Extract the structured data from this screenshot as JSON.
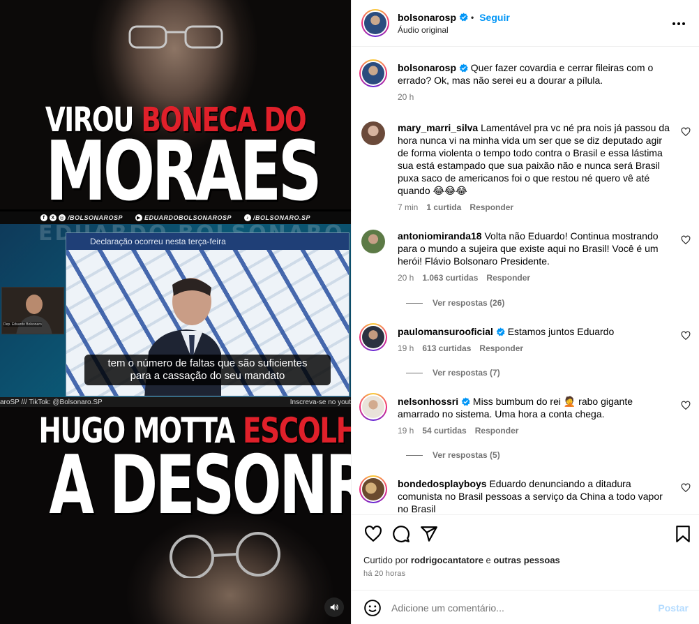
{
  "media": {
    "headline_top_white": "VIROU ",
    "headline_top_red": "BONECA DO",
    "headline_big_top": "MORAES",
    "social_handle_1": "/BOLSONAROSP",
    "social_handle_2": "EDUARDOBOLSONAROSP",
    "social_handle_3": "/BOLSONARO.SP",
    "video_bg_name": "EDUARDO BOLSONARO",
    "news_lower_third": "Declaração ocorreu nesta terça-feira",
    "caption_line_1": "tem o número de faltas que são suficientes",
    "caption_line_2": "para a cassação do seu mandato",
    "pip_label": "Dep. Eduardo Bolsonaro",
    "video_bar_left": "aroSP /// TikTok: @Bolsonaro.SP",
    "video_bar_right": "Inscreva-se no yout",
    "headline_bottom_white": "HUGO MOTTA ",
    "headline_bottom_red": "ESCOLHEU",
    "headline_big_bottom": "A DESONRA"
  },
  "header": {
    "username": "bolsonarosp",
    "bullet": "•",
    "follow_label": "Seguir",
    "audio_label": "Áudio original"
  },
  "caption": {
    "username": "bolsonarosp",
    "text": "Quer fazer covardia e cerrar fileiras com o errado? Ok, mas não serei eu a dourar a pílula.",
    "time": "20 h"
  },
  "comments": [
    {
      "username": "mary_marri_silva",
      "text": "Lamentável pra vc né pra nois já passou da hora nunca vi na minha vida um ser que se diz deputado agir de forma violenta o tempo todo contra o Brasil e essa lástima sua está estampado que sua paixão não e nunca será Brasil puxa saco de americanos foi o que restou né quero vê até quando 😂😂😂",
      "time": "7 min",
      "likes": "1 curtida",
      "reply": "Responder"
    },
    {
      "username": "antoniomiranda18",
      "text": "Volta não Eduardo! Continua mostrando para o mundo a sujeira que existe aqui no Brasil! Você é um herói! Flávio Bolsonaro Presidente.",
      "time": "20 h",
      "likes": "1.063 curtidas",
      "reply": "Responder",
      "view_replies": "Ver respostas (26)"
    },
    {
      "username": "paulomansurooficial",
      "text": "Estamos juntos Eduardo",
      "time": "19 h",
      "likes": "613 curtidas",
      "reply": "Responder",
      "view_replies": "Ver respostas (7)"
    },
    {
      "username": "nelsonhossri",
      "text": "Miss bumbum do rei 🤦 rabo gigante amarrado no sistema. Uma hora a conta chega.",
      "time": "19 h",
      "likes": "54 curtidas",
      "reply": "Responder",
      "view_replies": "Ver respostas (5)"
    },
    {
      "username": "bondedosplayboys",
      "text": "Eduardo denunciando a ditadura comunista no Brasil pessoas a serviço da China a todo vapor no Brasil"
    }
  ],
  "footer": {
    "liked_prefix": "Curtido por ",
    "liked_user": "rodrigocantatore",
    "liked_mid": " e ",
    "liked_others": "outras pessoas",
    "time_ago": "há 20 horas",
    "comment_placeholder": "Adicione um comentário...",
    "post_label": "Postar"
  },
  "colors": {
    "accent_blue": "#0095f6",
    "headline_red": "#e0202a",
    "post_disabled": "#b3dbff",
    "muted_text": "#737373"
  },
  "icons": [
    "verified-badge-icon",
    "more-options-icon",
    "heart-icon",
    "comment-icon",
    "share-icon",
    "save-icon",
    "emoji-icon",
    "audio-icon",
    "facebook-icon",
    "x-icon",
    "instagram-icon",
    "youtube-icon",
    "tiktok-icon"
  ]
}
